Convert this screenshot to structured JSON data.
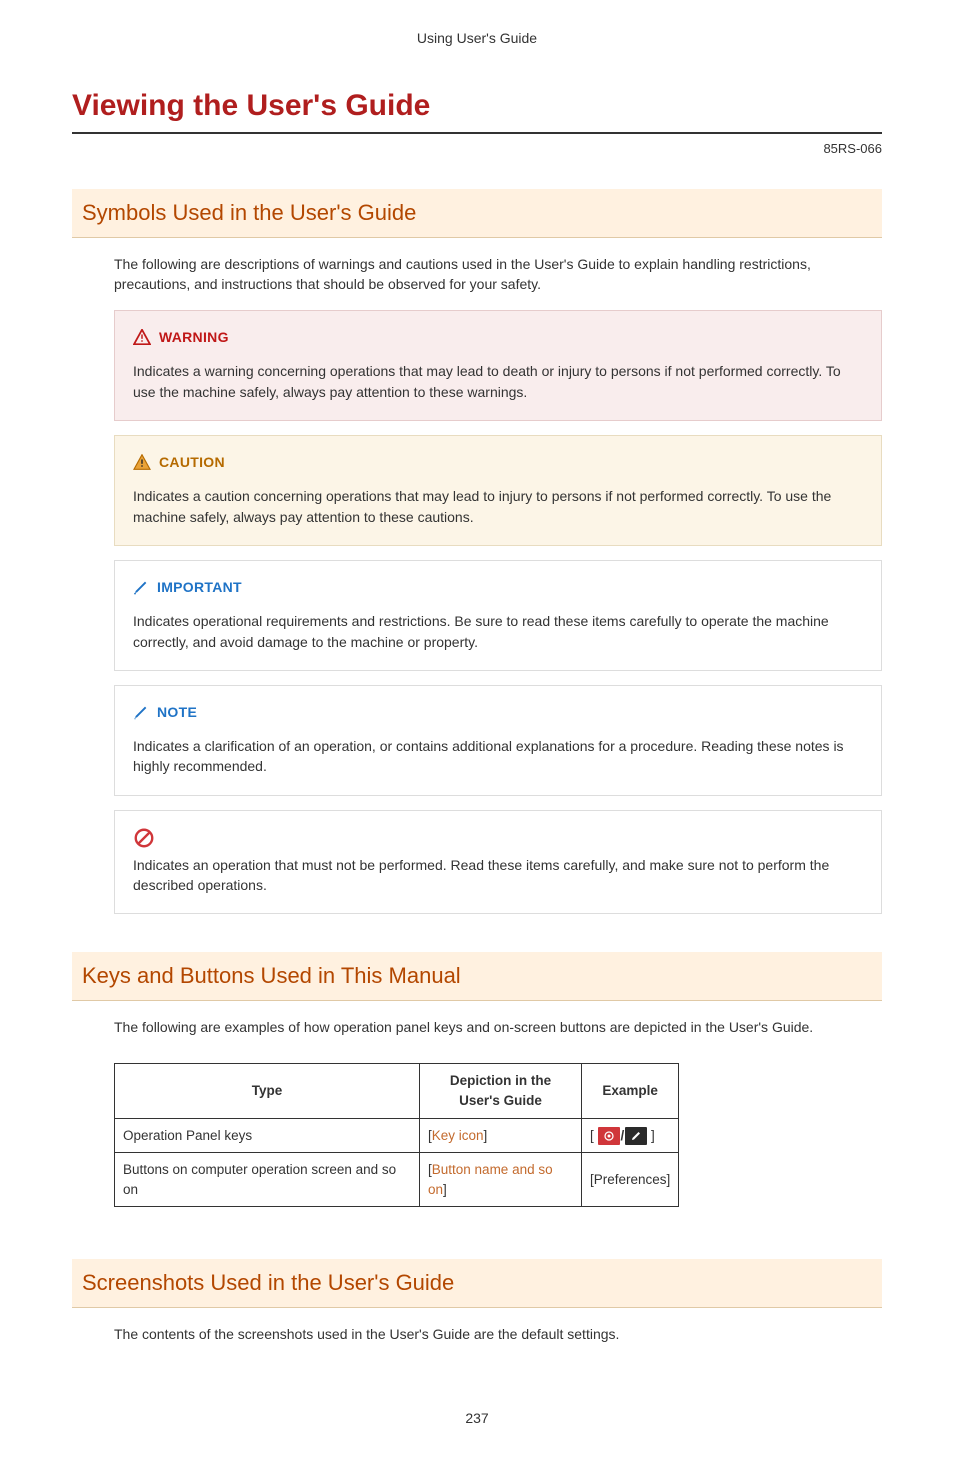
{
  "header": {
    "breadcrumb": "Using User's Guide"
  },
  "title": "Viewing the User's Guide",
  "doc_code": "85RS-066",
  "sections": {
    "symbols": {
      "heading": "Symbols Used in the User's Guide",
      "intro": "The following are descriptions of warnings and cautions used in the User's Guide to explain handling restrictions, precautions, and instructions that should be observed for your safety.",
      "callouts": {
        "warning": {
          "label": "WARNING",
          "body": "Indicates a warning concerning operations that may lead to death or injury to persons if not performed correctly. To use the machine safely, always pay attention to these warnings."
        },
        "caution": {
          "label": "CAUTION",
          "body": "Indicates a caution concerning operations that may lead to injury to persons if not performed correctly. To use the machine safely, always pay attention to these cautions."
        },
        "important": {
          "label": "IMPORTANT",
          "body": "Indicates operational requirements and restrictions. Be sure to read these items carefully to operate the machine correctly, and avoid damage to the machine or property."
        },
        "note": {
          "label": "NOTE",
          "body": "Indicates a clarification of an operation, or contains additional explanations for a procedure. Reading these notes is highly recommended."
        },
        "prohibit": {
          "body": "Indicates an operation that must not be performed. Read these items carefully, and make sure not to perform the described operations."
        }
      }
    },
    "keys": {
      "heading": "Keys and Buttons Used in This Manual",
      "intro": "The following are examples of how operation panel keys and on-screen buttons are depicted in the User's Guide.",
      "table": {
        "headers": {
          "type": "Type",
          "depiction": "Depiction in the User's Guide",
          "example": "Example"
        },
        "rows": [
          {
            "type": "Operation Panel keys",
            "depiction_before": "[",
            "depiction_inner": "Key icon",
            "depiction_after": "]",
            "example_prefix": "[ ",
            "example_suffix": " ]",
            "example_key_sep": "/"
          },
          {
            "type": "Buttons on computer operation screen and so on",
            "depiction_before": "[",
            "depiction_inner": "Button name and so on",
            "depiction_after": "]",
            "example_text": "[Preferences]"
          }
        ]
      }
    },
    "screenshots": {
      "heading": "Screenshots Used in the User's Guide",
      "intro": "The contents of the screenshots used in the User's Guide are the default settings."
    }
  },
  "page_number": "237"
}
